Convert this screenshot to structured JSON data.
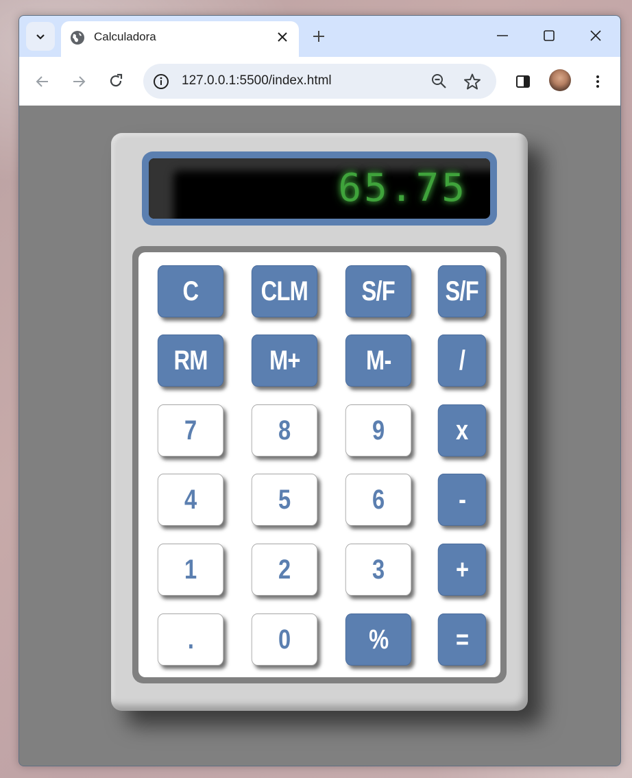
{
  "browser": {
    "tab_title": "Calculadora",
    "url": "127.0.0.1:5500/index.html"
  },
  "calculator": {
    "display": "65.75",
    "keys": {
      "r1": [
        "C",
        "CLM",
        "S/F",
        "S/F"
      ],
      "r2": [
        "RM",
        "M+",
        "M-",
        "/"
      ],
      "r3": [
        "7",
        "8",
        "9",
        "x"
      ],
      "r4": [
        "4",
        "5",
        "6",
        "-"
      ],
      "r5": [
        "1",
        "2",
        "3",
        "+"
      ],
      "r6": [
        ".",
        "0",
        "%",
        "="
      ]
    }
  },
  "colors": {
    "accent": "#5b7fb0",
    "display_text": "#3fa33b",
    "body": "#d3d3d3",
    "page_bg": "#808080"
  },
  "icons": {
    "tab_list": "chevron-down-icon",
    "favicon": "globe-icon",
    "close": "close-icon",
    "new_tab": "plus-icon",
    "back": "arrow-left-icon",
    "forward": "arrow-right-icon",
    "reload": "reload-icon",
    "site_info": "info-icon",
    "zoom": "zoom-out-icon",
    "bookmark": "star-icon",
    "side_panel": "side-panel-icon",
    "menu": "kebab-menu-icon"
  }
}
